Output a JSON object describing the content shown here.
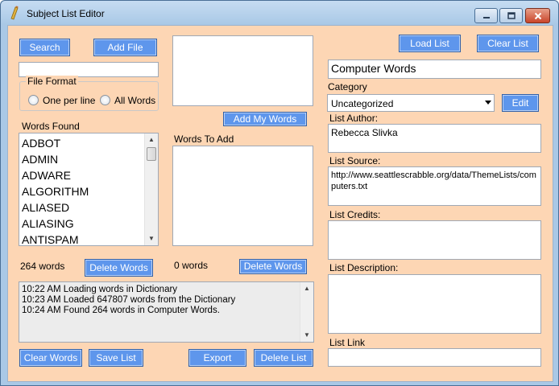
{
  "window": {
    "title": "Subject List Editor"
  },
  "left": {
    "search_label": "Search",
    "add_file_label": "Add File",
    "search_value": "",
    "file_format": {
      "title": "File Format",
      "options": [
        "One per line",
        "All Words"
      ]
    },
    "words_found_label": "Words Found",
    "words_found": [
      "ADBOT",
      "ADMIN",
      "ADWARE",
      "ALGORITHM",
      "ALIASED",
      "ALIASING",
      "ANTISPAM"
    ],
    "word_count": "264 words",
    "delete_words_label": "Delete Words",
    "log_lines": [
      "10:22 AM Loading words in Dictionary",
      "10:23 AM Loaded 647807 words from the Dictionary",
      "10:24 AM Found 264 words in Computer Words."
    ],
    "clear_words_label": "Clear Words",
    "save_list_label": "Save List"
  },
  "middle": {
    "my_words_value": "",
    "add_my_words_label": "Add My Words",
    "words_to_add_label": "Words To Add",
    "words_to_add": [],
    "word_count": "0 words",
    "delete_words_label": "Delete Words",
    "export_label": "Export",
    "delete_list_label": "Delete List"
  },
  "right": {
    "load_list_label": "Load List",
    "clear_list_label": "Clear List",
    "list_name": "Computer Words",
    "category_label": "Category",
    "category_value": "Uncategorized",
    "edit_label": "Edit",
    "author_label": "List Author:",
    "author_value": "Rebecca Slivka",
    "source_label": "List Source:",
    "source_line1": "http://www.seattlescrabble.org/data/ThemeLists/com",
    "source_line2": "puters.txt",
    "credits_label": "List Credits:",
    "credits_value": "",
    "description_label": "List Description:",
    "description_value": "",
    "link_label": "List Link",
    "link_value": ""
  },
  "colors": {
    "client_bg": "#fdd6b4",
    "button_bg": "#5e96ec",
    "titlebar": "#a9c8e6",
    "close_button": "#c9452a"
  }
}
